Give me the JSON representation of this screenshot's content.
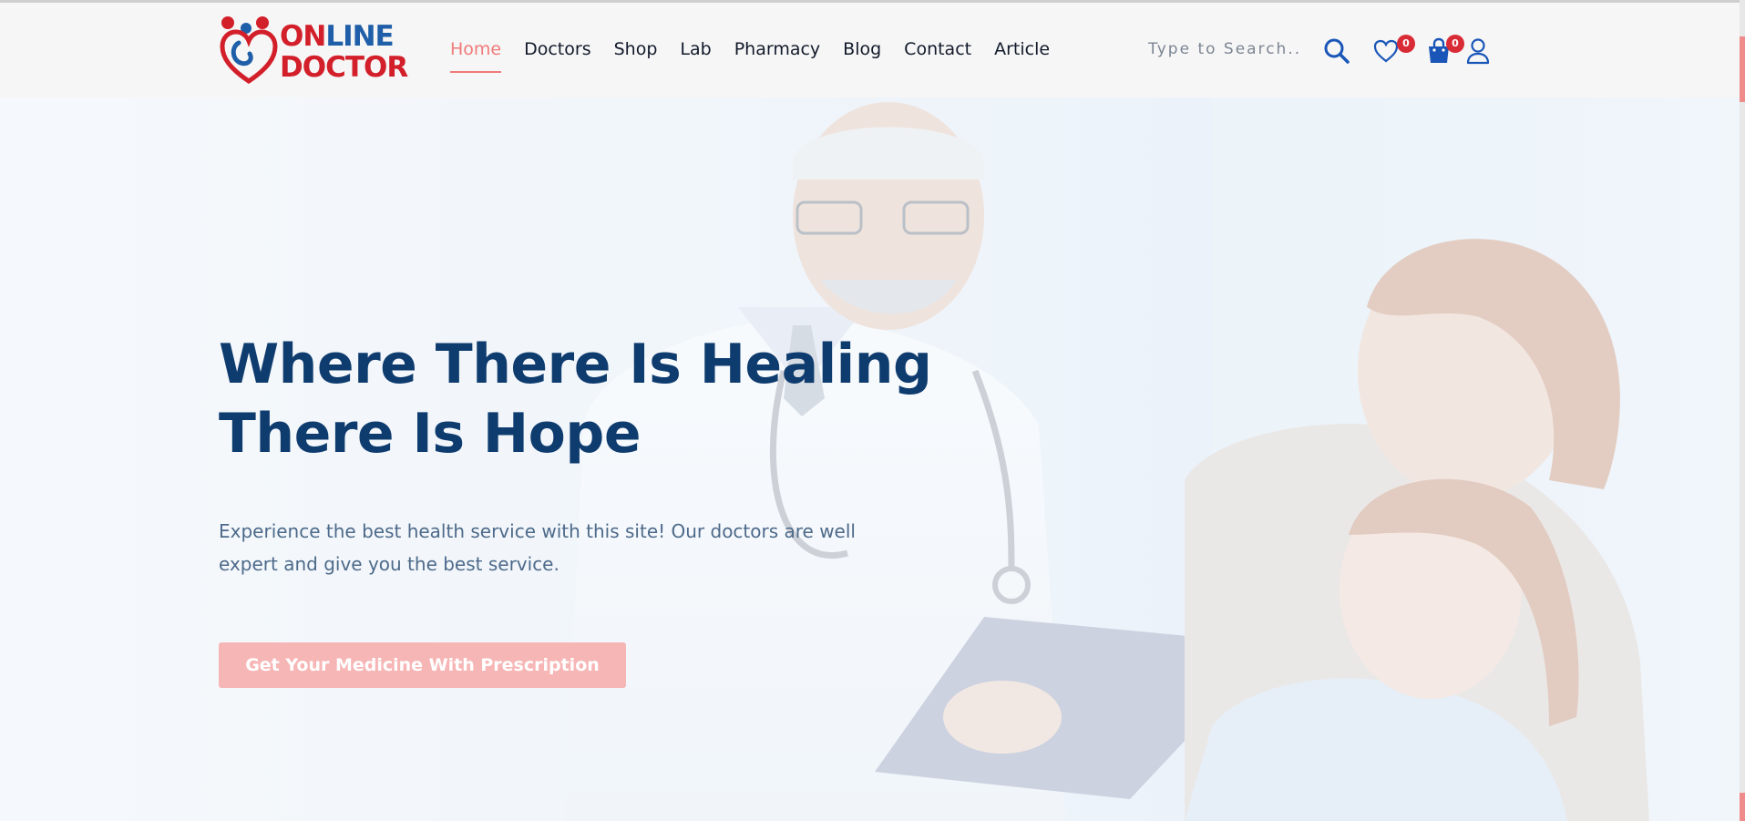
{
  "brand": {
    "logo_line1_a": "ON",
    "logo_line1_b": "LINE",
    "logo_line2": "DOCTOR",
    "colors": {
      "red": "#d21f2a",
      "blue": "#1f5ea8"
    }
  },
  "nav": {
    "items": [
      {
        "label": "Home",
        "active": true
      },
      {
        "label": "Doctors"
      },
      {
        "label": "Shop"
      },
      {
        "label": "Lab"
      },
      {
        "label": "Pharmacy"
      },
      {
        "label": "Blog"
      },
      {
        "label": "Contact"
      },
      {
        "label": "Article"
      }
    ],
    "active_color": "#f07a7a"
  },
  "header": {
    "search_placeholder": "Type to Search..",
    "wishlist_count": "0",
    "cart_count": "0",
    "icons": [
      "search-icon",
      "heart-icon",
      "shopping-bag-icon",
      "user-icon"
    ]
  },
  "hero": {
    "title_line1": "Where There Is Healing",
    "title_line2": "There Is Hope",
    "description": "Experience the best health service with this site! Our doctors are well expert and give you the best service.",
    "cta_label": "Get Your Medicine With Prescription",
    "title_color": "#0f3c6e",
    "cta_color": "#f7b6b6"
  }
}
